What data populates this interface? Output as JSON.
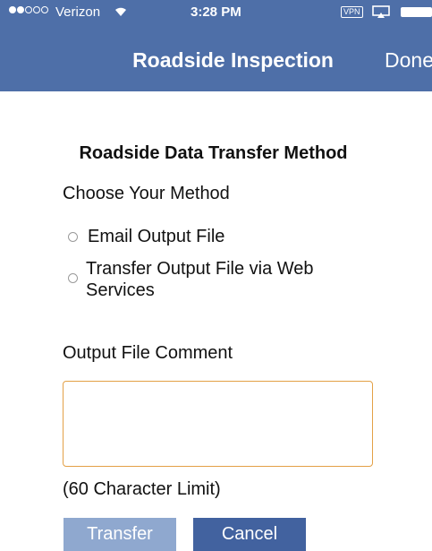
{
  "status_bar": {
    "carrier": "Verizon",
    "time": "3:28 PM",
    "vpn": "VPN",
    "signal_bars_filled": 2,
    "signal_bars_total": 5,
    "wifi_icon": "wifi-icon",
    "battery_icon": "battery-icon"
  },
  "nav": {
    "title": "Roadside Inspection",
    "done_label": "Done"
  },
  "form": {
    "section_title": "Roadside Data Transfer Method",
    "choose_label": "Choose Your Method",
    "options": [
      {
        "label": "Email Output File",
        "selected": false
      },
      {
        "label": "Transfer Output File via Web Services",
        "selected": false
      }
    ],
    "comment_label": "Output File Comment",
    "comment_value": "",
    "limit_note": "(60 Character Limit)"
  },
  "buttons": {
    "transfer_label": "Transfer",
    "cancel_label": "Cancel"
  },
  "colors": {
    "header": "#4e6fa8",
    "input_border": "#e3a046",
    "transfer_button": "#8fa8cf",
    "cancel_button": "#42629f"
  }
}
